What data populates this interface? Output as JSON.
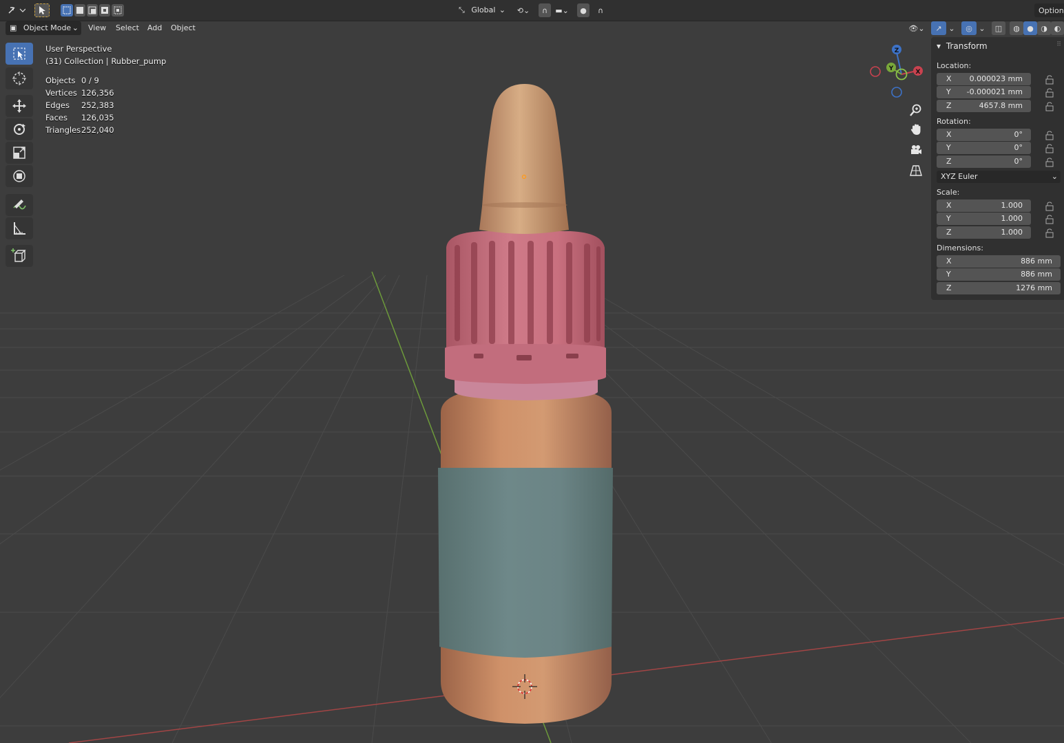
{
  "header": {
    "transform_orientation": "Global",
    "options_label": "Options",
    "mode": "Object Mode",
    "menus": [
      "View",
      "Select",
      "Add",
      "Object"
    ]
  },
  "viewport": {
    "view_name": "User Perspective",
    "collection": "(31) Collection | Rubber_pump",
    "stats": [
      {
        "label": "Objects",
        "value": "0 / 9"
      },
      {
        "label": "Vertices",
        "value": "126,356"
      },
      {
        "label": "Edges",
        "value": "252,383"
      },
      {
        "label": "Faces",
        "value": "126,035"
      },
      {
        "label": "Triangles",
        "value": "252,040"
      }
    ]
  },
  "tools": [
    "select-box-icon",
    "cursor-icon",
    "move-icon",
    "rotate-icon",
    "scale-icon",
    "transform-icon",
    "annotate-icon",
    "measure-icon",
    "add-cube-icon"
  ],
  "gizmo": {
    "x": "X",
    "y": "Y",
    "z": "Z"
  },
  "panel": {
    "title": "Transform",
    "location_label": "Location:",
    "location": [
      {
        "axis": "X",
        "value": "0.000023 mm"
      },
      {
        "axis": "Y",
        "value": "-0.000021 mm"
      },
      {
        "axis": "Z",
        "value": "4657.8 mm"
      }
    ],
    "rotation_label": "Rotation:",
    "rotation": [
      {
        "axis": "X",
        "value": "0°"
      },
      {
        "axis": "Y",
        "value": "0°"
      },
      {
        "axis": "Z",
        "value": "0°"
      }
    ],
    "rotation_mode": "XYZ Euler",
    "scale_label": "Scale:",
    "scale": [
      {
        "axis": "X",
        "value": "1.000"
      },
      {
        "axis": "Y",
        "value": "1.000"
      },
      {
        "axis": "Z",
        "value": "1.000"
      }
    ],
    "dimensions_label": "Dimensions:",
    "dimensions": [
      {
        "axis": "X",
        "value": "886 mm"
      },
      {
        "axis": "Y",
        "value": "886 mm"
      },
      {
        "axis": "Z",
        "value": "1276 mm"
      }
    ]
  },
  "colors": {
    "background": "#3d3d3d",
    "grid": "#4a4a4a",
    "x_axis": "#a34545",
    "y_axis": "#6d9a3b",
    "accent": "#4772b3",
    "bottle_orange": "#c98a62",
    "cap_pink": "#c7707f",
    "label_teal": "#6a8385"
  }
}
